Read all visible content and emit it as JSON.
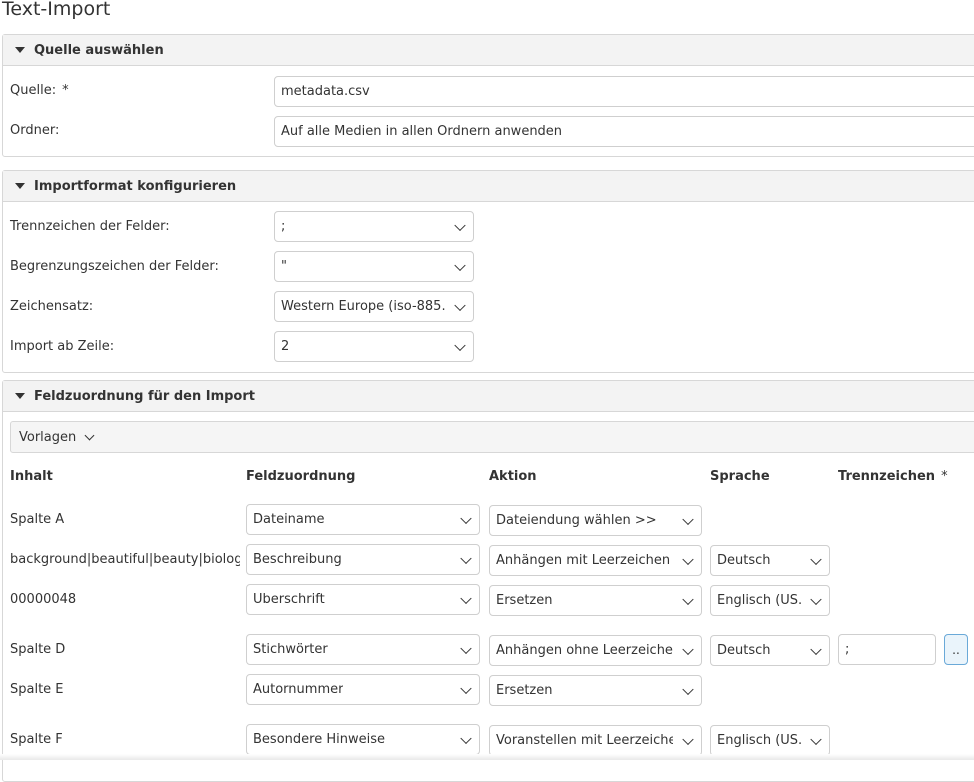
{
  "page_title": "Text-Import",
  "required_marker": "*",
  "source_panel": {
    "title": "Quelle auswählen",
    "quelle_label": "Quelle:",
    "quelle_value": "metadata.csv",
    "ordner_label": "Ordner:",
    "ordner_value": "Auf alle Medien in allen Ordnern anwenden"
  },
  "format_panel": {
    "title": "Importformat konfigurieren",
    "field_separator_label": "Trennzeichen der Felder:",
    "field_separator_value": ";",
    "field_delimiter_label": "Begrenzungszeichen der Felder:",
    "field_delimiter_value": "\"",
    "charset_label": "Zeichensatz:",
    "charset_value": "Western Europe (iso-885...",
    "start_row_label": "Import ab Zeile:",
    "start_row_value": "2"
  },
  "mapping_panel": {
    "title": "Feldzuordnung für den Import",
    "templates_label": "Vorlagen",
    "columns": {
      "content": "Inhalt",
      "mapping": "Feldzuordnung",
      "action": "Aktion",
      "language": "Sprache",
      "separator": "Trennzeichen"
    },
    "rows": [
      {
        "content": "Spalte A",
        "mapping": "Dateiname",
        "action": "Dateiendung wählen >>"
      },
      {
        "content": "background|beautiful|beauty|biology",
        "mapping": "Beschreibung",
        "action": "Anhängen mit Leerzeichen",
        "language": "Deutsch"
      },
      {
        "content": "00000048",
        "mapping": "Uberschrift",
        "action": "Ersetzen",
        "language": "Englisch (US..."
      },
      {
        "content": "Spalte D",
        "mapping": "Stichwörter",
        "action": "Anhängen ohne Leerzeichen",
        "language": "Deutsch",
        "separator": ";",
        "more": ".."
      },
      {
        "content": "Spalte E",
        "mapping": "Autornummer",
        "action": "Ersetzen"
      },
      {
        "content": "Spalte F",
        "mapping": "Besondere Hinweise",
        "action": "Voranstellen mit Leerzeichen",
        "language": "Englisch (US..."
      }
    ]
  },
  "icons": {
    "collapse": "triangle-down-icon",
    "dropdown": "chevron-down-icon"
  }
}
